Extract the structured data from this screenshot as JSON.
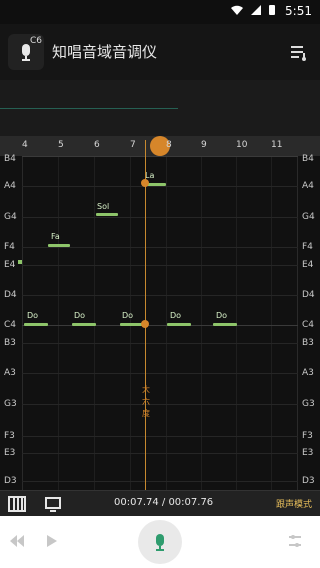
{
  "status_bar": {
    "time": "5:51"
  },
  "app": {
    "title": "知唱音域音调仪",
    "logo_badge": "C6"
  },
  "ruler": {
    "ticks": [
      "4",
      "5",
      "6",
      "7",
      "8",
      "9",
      "10",
      "11"
    ]
  },
  "left_notes": [
    "B4",
    "A4",
    "G4",
    "F4",
    "E4",
    "D4",
    "C4",
    "B3",
    "A3",
    "G3",
    "F3",
    "E3",
    "D3"
  ],
  "right_notes": [
    "B4",
    "A4",
    "G4",
    "F4",
    "E4",
    "D4",
    "C4",
    "B3",
    "A3",
    "G3",
    "F3",
    "E3",
    "D3"
  ],
  "note_labels": [
    "Do",
    "Do",
    "Do",
    "Do",
    "Do",
    "Fa",
    "Sol",
    "La"
  ],
  "interval_label": "大六度",
  "timer": "00:07.74 / 00:07.76",
  "mode_label": "跟声模式",
  "colors": {
    "accent": "#d6862a",
    "note": "#8ec56a",
    "mic": "#2e9c6e"
  }
}
